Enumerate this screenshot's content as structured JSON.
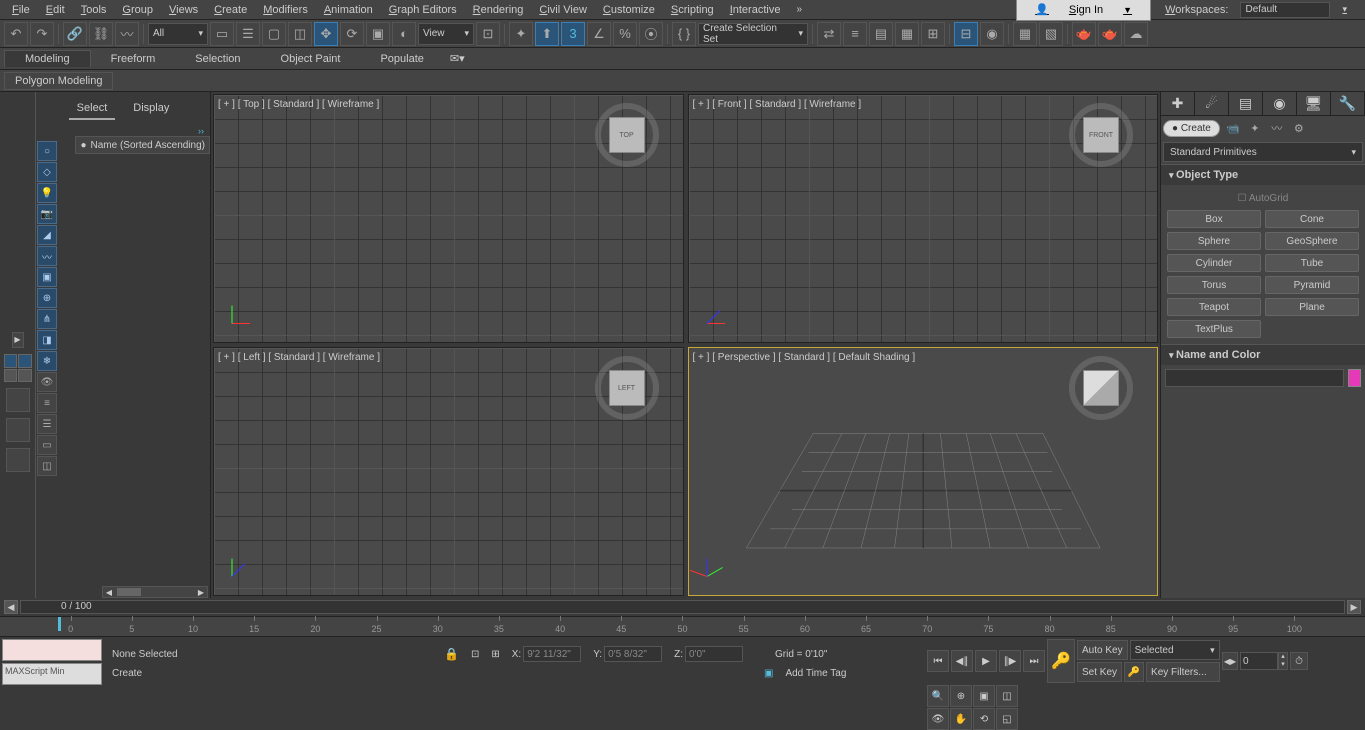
{
  "menu": {
    "items": [
      "File",
      "Edit",
      "Tools",
      "Group",
      "Views",
      "Create",
      "Modifiers",
      "Animation",
      "Graph Editors",
      "Rendering",
      "Civil View",
      "Customize",
      "Scripting",
      "Interactive"
    ],
    "signin": "Sign In",
    "workspaces_label": "Workspaces:",
    "workspace": "Default"
  },
  "toolbar": {
    "dd_all": "All",
    "dd_view": "View",
    "dd_selset": "Create Selection Set"
  },
  "ribbon": {
    "tabs": [
      "Modeling",
      "Freeform",
      "Selection",
      "Object Paint",
      "Populate"
    ],
    "sub": "Polygon Modeling"
  },
  "sceneexp": {
    "tabs": [
      "Select",
      "Display"
    ],
    "header": "Name (Sorted Ascending)"
  },
  "viewports": {
    "top": "[ + ] [ Top ] [ Standard ] [ Wireframe ]",
    "front": "[ + ] [ Front ] [ Standard ] [ Wireframe ]",
    "left": "[ + ] [ Left ] [ Standard ] [ Wireframe ]",
    "persp": "[ + ] [ Perspective ] [ Standard ] [ Default Shading ]",
    "cube_top": "TOP",
    "cube_front": "FRONT",
    "cube_left": "LEFT"
  },
  "cmdpanel": {
    "create": "Create",
    "dd": "Standard Primitives",
    "rollout_ot": "Object Type",
    "autogrid": "AutoGrid",
    "buttons": [
      "Box",
      "Cone",
      "Sphere",
      "GeoSphere",
      "Cylinder",
      "Tube",
      "Torus",
      "Pyramid",
      "Teapot",
      "Plane",
      "TextPlus"
    ],
    "rollout_nc": "Name and Color"
  },
  "timeslider": {
    "value": "0 / 100",
    "ticks": [
      0,
      5,
      10,
      15,
      20,
      25,
      30,
      35,
      40,
      45,
      50,
      55,
      60,
      65,
      70,
      75,
      80,
      85,
      90,
      95,
      100
    ]
  },
  "status": {
    "maxscript": "MAXScript Min",
    "none": "None Selected",
    "create": "Create",
    "x_label": "X:",
    "x": "9'2 11/32\"",
    "y_label": "Y:",
    "y": "0'5 8/32\"",
    "z_label": "Z:",
    "z": "0'0\"",
    "grid": "Grid = 0'10\"",
    "add_time_tag": "Add Time Tag",
    "autokey": "Auto Key",
    "setkey": "Set Key",
    "selected": "Selected",
    "keyfilters": "Key Filters...",
    "frame": "0"
  }
}
